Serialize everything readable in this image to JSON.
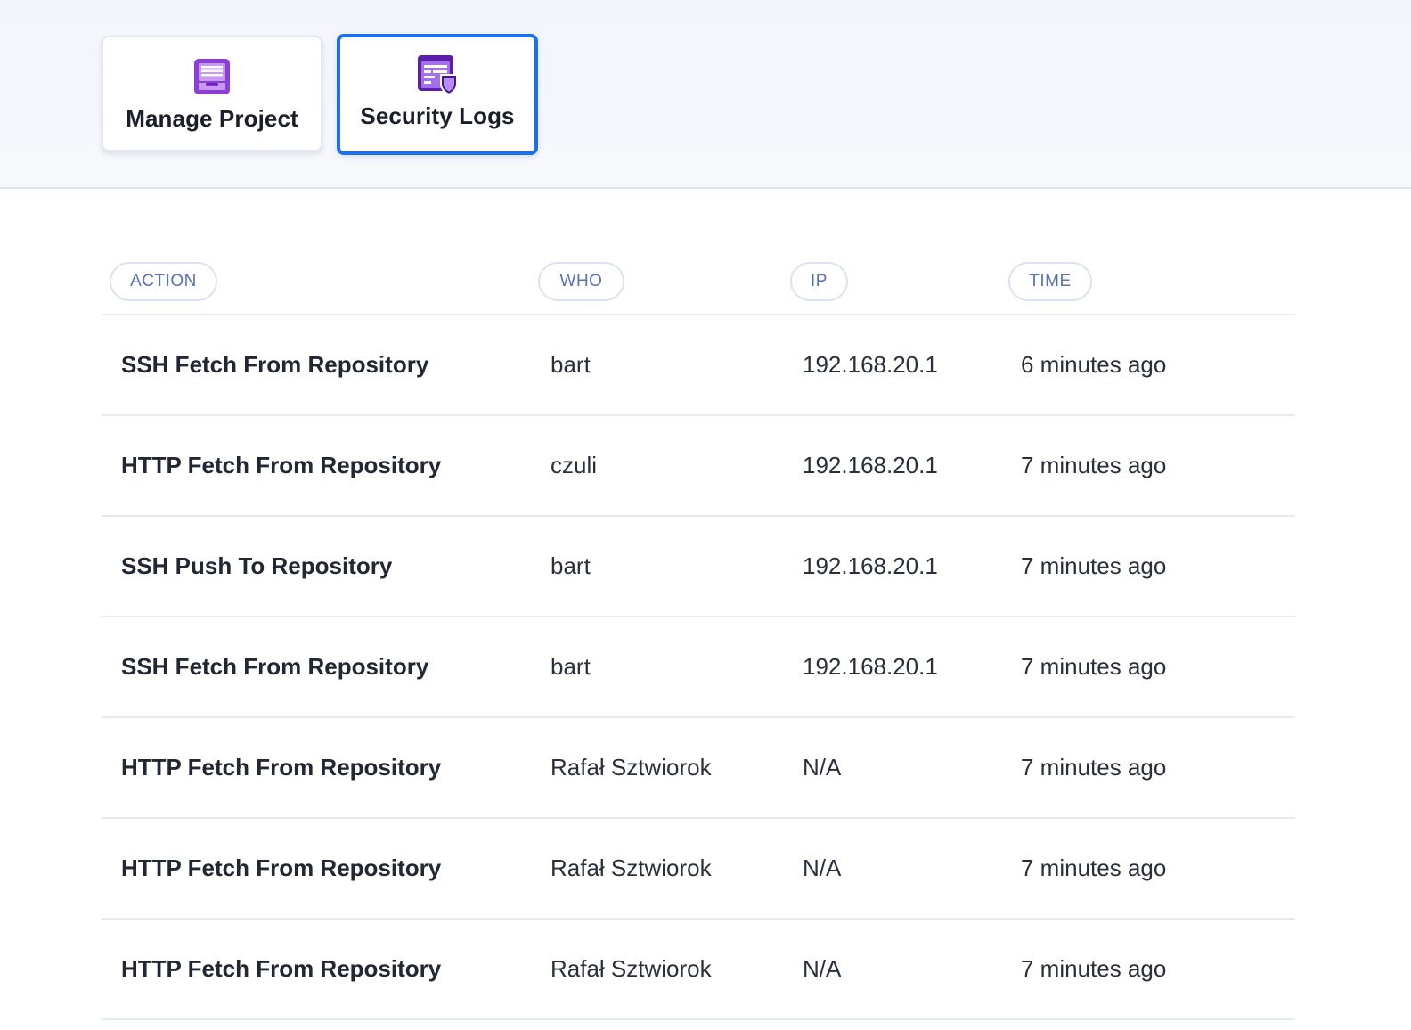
{
  "tabs": {
    "manage": {
      "label": "Manage Project",
      "icon": "project-inbox-icon"
    },
    "security": {
      "label": "Security Logs",
      "icon": "security-log-shield-icon",
      "active": true
    }
  },
  "colors": {
    "accent": "#1f6fe5",
    "icon_purple": "#8b3fd6",
    "header_pill_text": "#5872b6"
  },
  "table": {
    "headers": {
      "action": "ACTION",
      "who": "WHO",
      "ip": "IP",
      "time": "TIME"
    },
    "rows": [
      {
        "action": "SSH Fetch From Repository",
        "who": "bart",
        "ip": "192.168.20.1",
        "time": "6 minutes ago"
      },
      {
        "action": "HTTP Fetch From Repository",
        "who": "czuli",
        "ip": "192.168.20.1",
        "time": "7 minutes ago"
      },
      {
        "action": "SSH Push To Repository",
        "who": "bart",
        "ip": "192.168.20.1",
        "time": "7 minutes ago"
      },
      {
        "action": "SSH Fetch From Repository",
        "who": "bart",
        "ip": "192.168.20.1",
        "time": "7 minutes ago"
      },
      {
        "action": "HTTP Fetch From Repository",
        "who": "Rafał Sztwiorok",
        "ip": "N/A",
        "time": "7 minutes ago"
      },
      {
        "action": "HTTP Fetch From Repository",
        "who": "Rafał Sztwiorok",
        "ip": "N/A",
        "time": "7 minutes ago"
      },
      {
        "action": "HTTP Fetch From Repository",
        "who": "Rafał Sztwiorok",
        "ip": "N/A",
        "time": "7 minutes ago"
      }
    ]
  }
}
